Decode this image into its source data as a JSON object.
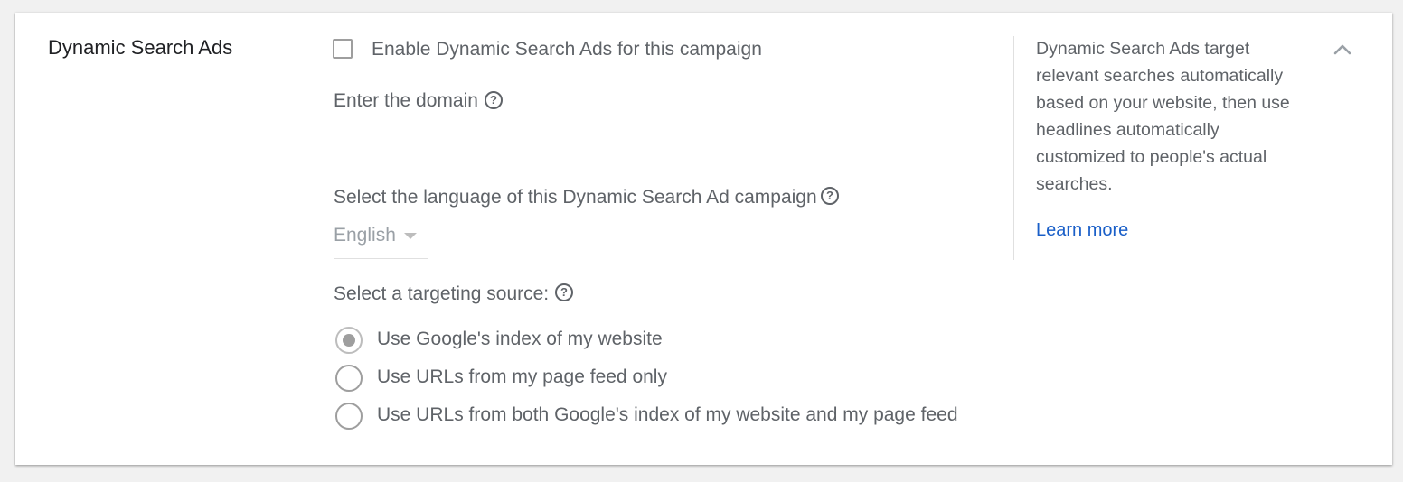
{
  "section": {
    "title": "Dynamic Search Ads"
  },
  "enable_checkbox": {
    "label": "Enable Dynamic Search Ads for this campaign",
    "checked": false
  },
  "domain": {
    "label": "Enter the domain",
    "value": "",
    "help_icon": "help-circle-icon"
  },
  "language": {
    "label": "Select the language of this Dynamic Search Ad campaign",
    "selected": "English",
    "help_icon": "help-circle-icon"
  },
  "targeting": {
    "label": "Select a targeting source:",
    "help_icon": "help-circle-icon",
    "options": [
      {
        "label": "Use Google's index of my website",
        "checked": true
      },
      {
        "label": "Use URLs from my page feed only",
        "checked": false
      },
      {
        "label": "Use URLs from both Google's index of my website and my page feed",
        "checked": false
      }
    ]
  },
  "sidebar": {
    "description_lines": [
      "Dynamic Search Ads target",
      "relevant searches automatically",
      "based on your website, then use",
      "headlines automatically",
      "customized to people's actual",
      "searches."
    ],
    "learn_more": "Learn more",
    "collapse_icon": "chevron-up-icon"
  },
  "colors": {
    "link": "#1a5fc8",
    "text": "#5f6368",
    "title": "#202124",
    "background": "#f1f1f1",
    "card": "#ffffff"
  }
}
